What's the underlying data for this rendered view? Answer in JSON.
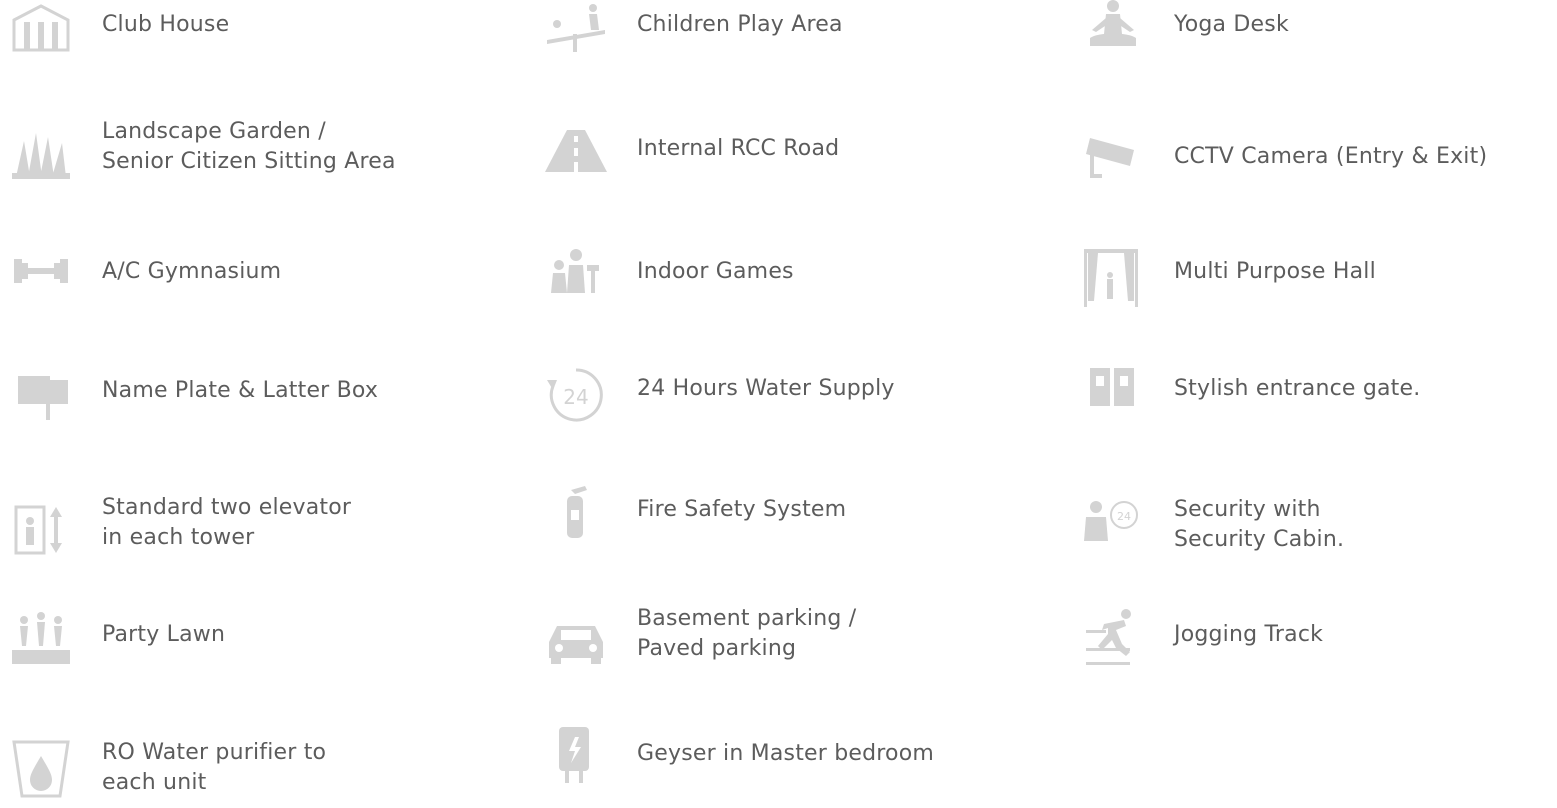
{
  "amenities": [
    {
      "lines": [
        "Club House"
      ],
      "icon": "club-house-icon"
    },
    {
      "lines": [
        "Children Play Area"
      ],
      "icon": "children-play-icon"
    },
    {
      "lines": [
        "Yoga Desk"
      ],
      "icon": "yoga-icon"
    },
    {
      "lines": [
        "Landscape Garden /",
        "Senior Citizen Sitting Area"
      ],
      "icon": "garden-icon"
    },
    {
      "lines": [
        "Internal RCC Road"
      ],
      "icon": "road-icon"
    },
    {
      "lines": [
        "CCTV Camera (Entry & Exit)"
      ],
      "icon": "cctv-camera-icon"
    },
    {
      "lines": [
        "A/C Gymnasium"
      ],
      "icon": "dumbbell-icon"
    },
    {
      "lines": [
        "Indoor Games"
      ],
      "icon": "chess-icon"
    },
    {
      "lines": [
        "Multi Purpose Hall"
      ],
      "icon": "hall-curtain-icon"
    },
    {
      "lines": [
        "Name Plate & Latter Box"
      ],
      "icon": "mailbox-icon"
    },
    {
      "lines": [
        "24 Hours Water Supply"
      ],
      "icon": "clock-24-icon"
    },
    {
      "lines": [
        "Stylish entrance gate."
      ],
      "icon": "gate-icon"
    },
    {
      "lines": [
        "Standard two elevator",
        "in each tower"
      ],
      "icon": "elevator-icon"
    },
    {
      "lines": [
        "Fire Safety System"
      ],
      "icon": "fire-extinguisher-icon"
    },
    {
      "lines": [
        "Security with",
        "Security Cabin."
      ],
      "icon": "security-guard-icon"
    },
    {
      "lines": [
        "Party Lawn"
      ],
      "icon": "party-icon"
    },
    {
      "lines": [
        "Basement parking /",
        "Paved parking"
      ],
      "icon": "car-icon"
    },
    {
      "lines": [
        "Jogging Track"
      ],
      "icon": "runner-icon"
    },
    {
      "lines": [
        "RO Water purifier to",
        "each unit"
      ],
      "icon": "water-drop-icon"
    },
    {
      "lines": [
        "Geyser in Master bedroom"
      ],
      "icon": "geyser-icon"
    }
  ],
  "colors": {
    "text": "#5c5c5c",
    "icon": "#d3d3d3",
    "background": "#ffffff"
  }
}
